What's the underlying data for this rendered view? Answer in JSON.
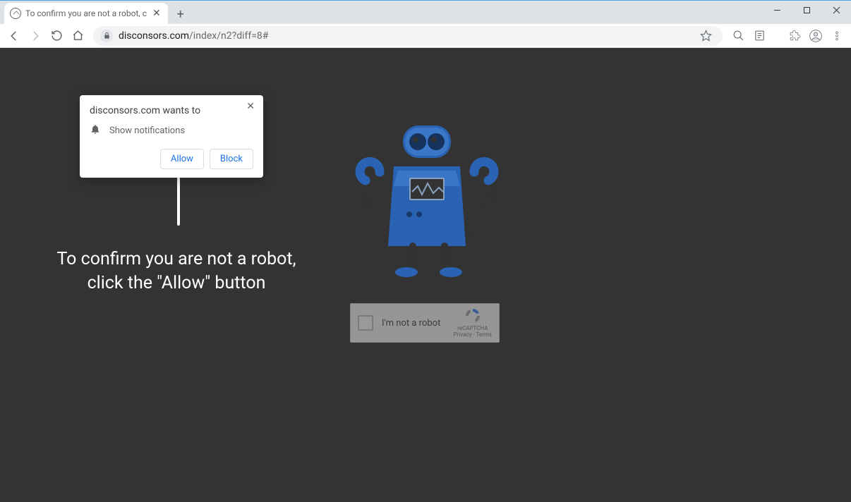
{
  "tab": {
    "title": "To confirm you are not a robot, c"
  },
  "toolbar": {
    "url_domain": "disconsors.com",
    "url_path": "/index/n2?diff=8#"
  },
  "permission": {
    "title": "disconsors.com wants to",
    "item": "Show notifications",
    "allow": "Allow",
    "block": "Block"
  },
  "page": {
    "line1": "To confirm you are not a robot,",
    "line2": "click the \"Allow\" button",
    "recaptcha_label": "I'm not a robot",
    "recaptcha_brand": "reCAPTCHA",
    "recaptcha_links": "Privacy - Terms"
  }
}
